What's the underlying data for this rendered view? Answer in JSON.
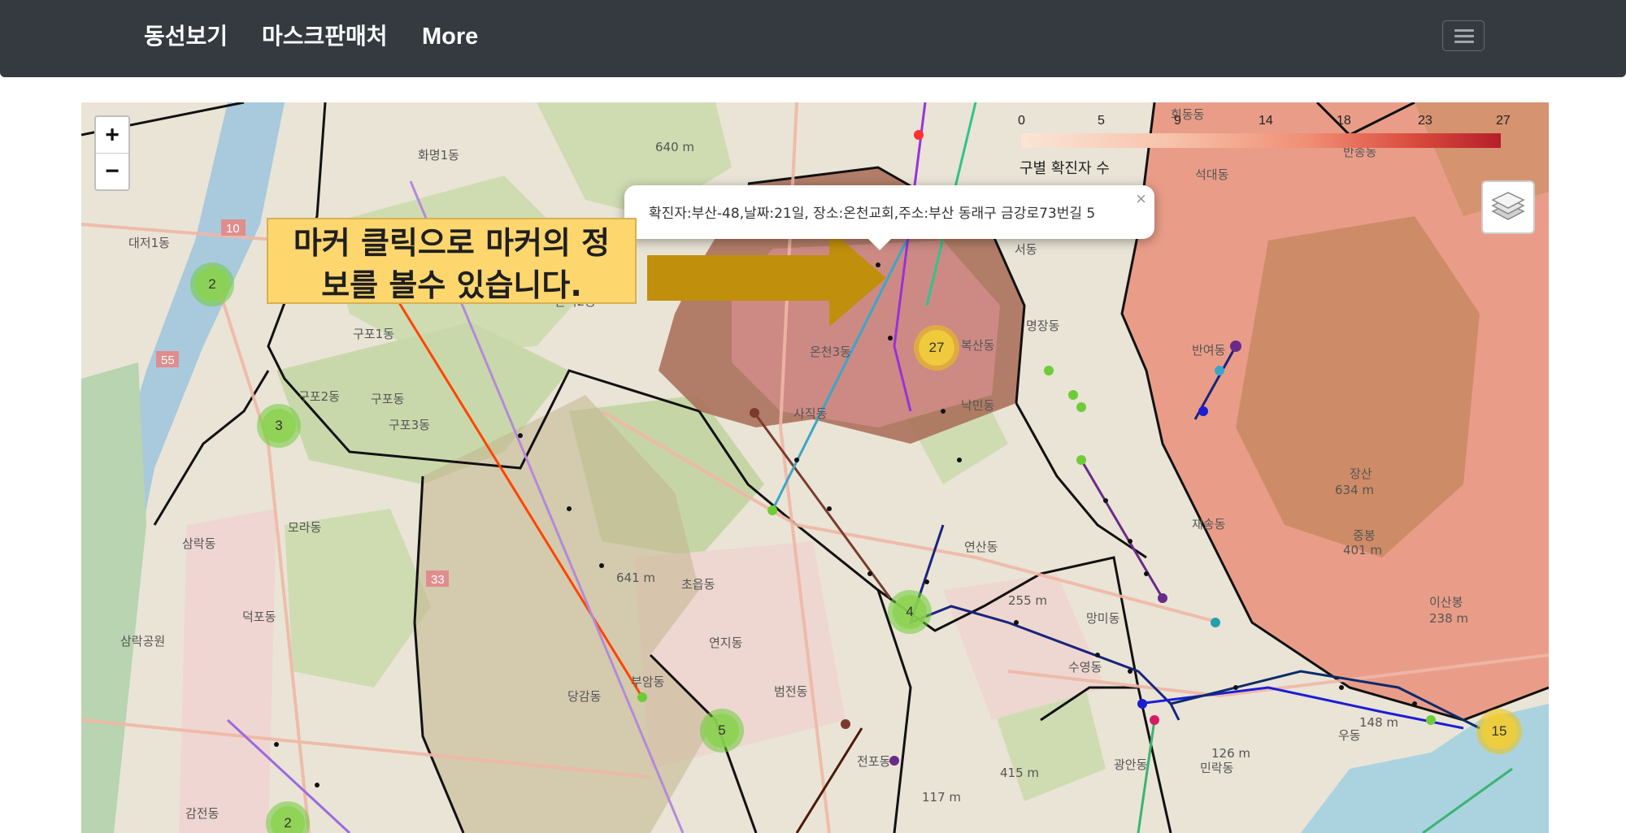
{
  "navbar": {
    "links": [
      "동선보기",
      "마스크판매처",
      "More"
    ]
  },
  "map": {
    "zoom_in": "+",
    "zoom_out": "−",
    "legend": {
      "ticks": [
        "0",
        "5",
        "9",
        "14",
        "18",
        "23",
        "27"
      ],
      "caption": "구별 확진자 수"
    },
    "popup": {
      "text": "확진자:부산-48,날짜:21일, 장소:온천교회,주소:부산 동래구 금강로73번길 5",
      "close": "×"
    },
    "annotation": {
      "line1": "마커 클릭으로 마커의 정",
      "line2": "보를 볼수 있습니다."
    },
    "clusters": [
      "2",
      "3",
      "27",
      "4",
      "5",
      "15",
      "2"
    ],
    "place_labels": [
      "화명1동",
      "대저1동",
      "구포1동",
      "구포2동",
      "구포동",
      "구포3동",
      "만덕2동",
      "온천3동",
      "복산동",
      "명장동",
      "사직동",
      "낙민동",
      "서동",
      "석대동",
      "반송동",
      "회동동",
      "반여동",
      "재송동",
      "모라동",
      "삼락동",
      "덕포동",
      "삼락공원",
      "초읍동",
      "연지동",
      "당감동",
      "부암동",
      "범전동",
      "연산동",
      "망미동",
      "수영동",
      "광안동",
      "민락동",
      "우동",
      "전포동",
      "감전동",
      "장산",
      "중봉",
      "이산봉"
    ],
    "elevations": [
      "640 m",
      "641 m",
      "255 m",
      "634 m",
      "401 m",
      "238 m",
      "148 m",
      "126 m",
      "415 m",
      "117 m"
    ],
    "road_numbers": [
      "10",
      "55",
      "33"
    ],
    "colors": {
      "navbar": "#343a40",
      "choropleth_high": "#8c2b2b",
      "choropleth_mid": "#e8887a",
      "annotation_bg": "#fdd66e",
      "arrow": "#c08f0c",
      "cluster_green": "#6ecc39",
      "cluster_yellow": "#f0c20c"
    },
    "icons": [
      "layers-icon",
      "hamburger-icon",
      "arrow-icon"
    ]
  }
}
